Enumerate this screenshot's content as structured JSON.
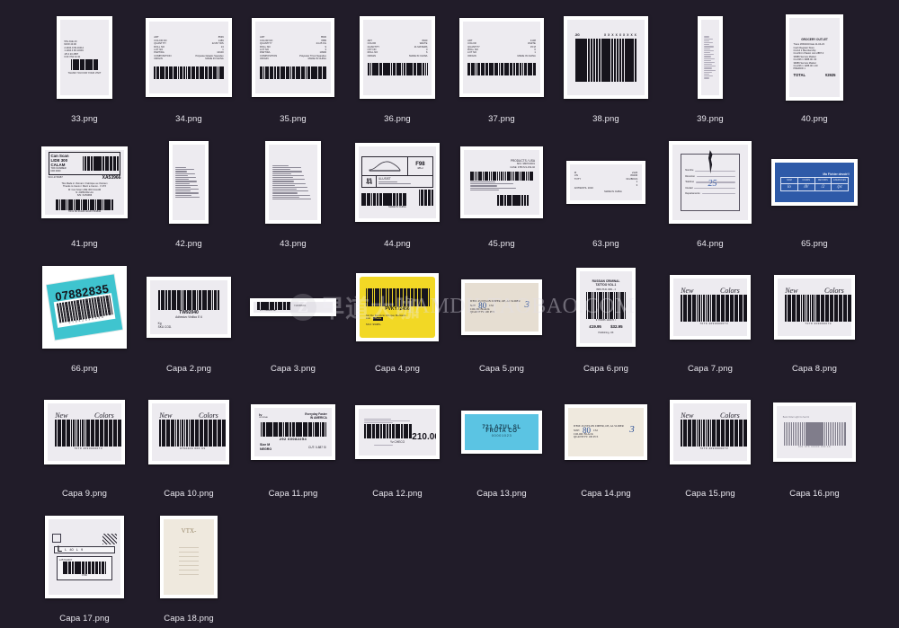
{
  "app": {
    "background_color": "#211c29",
    "view": "thumbnail-grid",
    "columns": 8
  },
  "watermark": {
    "logo_letter": "Z",
    "text_cn": "早道大咖",
    "text_en": "IAMDK.TAOBAO.COM"
  },
  "files": [
    {
      "name": "33.png",
      "kind": "receipt-tall",
      "w": 62,
      "h": 92,
      "paper": "paper",
      "content": {
        "lines": [
          "5TH AVE   20",
          "NOW 43.00",
          "2.2464.9  99.10414",
          "1.1194.4  90.13404",
          "1/5  4  20.4587",
          "0.00   7/64   44.31"
        ],
        "barcode": true,
        "footer": "THANK YOU FOR YOUR VISIT"
      }
    },
    {
      "name": "34.png",
      "kind": "care-label",
      "w": 96,
      "h": 88,
      "paper": "paper",
      "content": {
        "fields": [
          [
            "ART",
            "8539"
          ],
          [
            "COLOR NO",
            "1489"
          ],
          [
            "QUANTITY",
            "22.80 YDS"
          ],
          [
            "ROLL NO",
            "13"
          ],
          [
            "LOT NO",
            "1"
          ],
          [
            "PARTIDA",
            "10100"
          ],
          [
            "COMPOSITION",
            "Polyester Elastic Spandex"
          ],
          [
            "ORIGIN",
            "MADE IN CHINA"
          ]
        ],
        "barcode": true
      }
    },
    {
      "name": "35.png",
      "kind": "care-label",
      "w": 92,
      "h": 88,
      "paper": "paper",
      "content": {
        "fields": [
          [
            "ART",
            "8530"
          ],
          [
            "COLOR NO",
            "7885"
          ],
          [
            "QUANTITY",
            "24.25 KG"
          ],
          [
            "ROLL NO",
            "9"
          ],
          [
            "LOT NO",
            "3"
          ],
          [
            "PARTIDA",
            "10900"
          ],
          [
            "COMPOSITION",
            "Polyester Tricot Spandex"
          ],
          [
            "ORIGIN",
            "MADE IN CHINA"
          ]
        ],
        "barcode": true
      }
    },
    {
      "name": "36.png",
      "kind": "crumpled-label",
      "w": 84,
      "h": 92,
      "paper": "paper",
      "content": {
        "fields": [
          [
            "ART",
            "8020"
          ],
          [
            "COLOR",
            "WHITE"
          ],
          [
            "QUANTITY",
            "21 MATERS"
          ],
          [
            "LOT NO",
            "3"
          ],
          [
            "ROLL NO",
            "6"
          ],
          [
            "ORIGIN",
            "MADE IN CHINA"
          ]
        ],
        "barcode": true
      }
    },
    {
      "name": "37.png",
      "kind": "crumpled-label",
      "w": 94,
      "h": 88,
      "paper": "paper",
      "content": {
        "fields": [
          [
            "ART",
            "4138"
          ],
          [
            "COLOR",
            "WHITE"
          ],
          [
            "QUANTITY",
            "15 M"
          ],
          [
            "ROLL NO",
            "6"
          ],
          [
            "LOT NO",
            "1"
          ],
          [
            "ORIGIN",
            "MADE IN CHINA"
          ]
        ],
        "barcode": true
      }
    },
    {
      "name": "38.png",
      "kind": "big-barcode",
      "w": 94,
      "h": 92,
      "paper": "paper",
      "content": {
        "code": "X X X X X X X X X",
        "prefix": "JIG"
      }
    },
    {
      "name": "39.png",
      "kind": "narrow-strip",
      "w": 28,
      "h": 92,
      "paper": "paper",
      "content": {
        "lines": 22
      }
    },
    {
      "name": "40.png",
      "kind": "receipt-tall",
      "w": 64,
      "h": 96,
      "paper": "paper",
      "content": {
        "header": "GROCERY OUTLET",
        "lines": [
          "Trans  1650234    Date 11-04-23",
          "Cash Register         Store",
          "CL214  1  Membership",
          "CL1234  1  Plastic mini   2887.0",
          "30986   Service Market",
          "CL1336  1  3988.00        .00",
          "39089   Service Market",
          "CL1236  1  1288.00       1.00",
          "PREPAID 1"
        ],
        "total_label": "TOTAL",
        "total_value": "¥2925"
      }
    },
    {
      "name": "41.png",
      "kind": "shipping-label",
      "w": 96,
      "h": 80,
      "paper": "paper",
      "content": {
        "title1": "Can Scan",
        "title2": "LIDE 300",
        "title3": "CALAM",
        "sub1": "TRK NUMBER",
        "sub2": "DIR 0000",
        "ref": "XA53966",
        "barcode": true,
        "desc": [
          "TEL  Made in Vietnam / Fabrique au Vietnam",
          "Thanks to Canon / Merci a Canon   -   V  27X",
          "M:  Can Scan LIDE 300 CALAM",
          "N:  2486C002-AA",
          "S/N:   XA53966"
        ],
        "footer": "TR13  B1  0013D-4A3F1  56384d"
      }
    },
    {
      "name": "42.png",
      "kind": "receipt-tall",
      "w": 44,
      "h": 92,
      "paper": "paper",
      "content": {
        "lines": 16
      }
    },
    {
      "name": "43.png",
      "kind": "receipt-tall",
      "w": 62,
      "h": 92,
      "paper": "paper",
      "content": {
        "lines": 18
      }
    },
    {
      "name": "44.png",
      "kind": "shoe-box-label",
      "w": 94,
      "h": 88,
      "paper": "paper",
      "content": {
        "code": "F98",
        "art": "486-2",
        "size_label": "BR",
        "size": "44",
        "sku": "ILLUSIST",
        "barcode": true,
        "origin": "MADE IN CHINA"
      }
    },
    {
      "name": "45.png",
      "kind": "poly-bag-label",
      "w": 92,
      "h": 80,
      "paper": "paper",
      "content": {
        "company": "PRODUCTS / USA",
        "lines": [
          "SKU: 9867C0001",
          "CASE: 3781721-152-02"
        ],
        "barcode_top": true,
        "barcode_bottom": true
      }
    },
    {
      "name": "63.png",
      "kind": "torn-label",
      "w": 88,
      "h": 48,
      "paper": "paper",
      "content": {
        "fields": [
          [
            "M",
            "2120"
          ],
          [
            "UN",
            "80430"
          ],
          [
            "TOTY",
            "33.28KGS"
          ],
          [
            "",
            "1"
          ],
          [
            "",
            "3"
          ],
          [
            "ANTIESTIL 1010",
            ""
          ]
        ],
        "origin": "MADE IN CHINA"
      }
    },
    {
      "name": "64.png",
      "kind": "hand-ink-label",
      "w": 92,
      "h": 92,
      "paper": "paper",
      "content": {
        "fields": [
          "Nombre",
          "Direccion",
          "Telefono",
          "Ciudad",
          "Departamento"
        ],
        "ink": "25"
      }
    },
    {
      "name": "65.png",
      "kind": "blue-table-label",
      "w": 96,
      "h": 52,
      "paper": "blue",
      "content": {
        "title": "Ma Fichier devoir!!",
        "headers": [
          "NOM",
          "COURS",
          "DEVOIRS",
          "EXERCICES"
        ],
        "cells": [
          "lo",
          "/8/",
          "/2",
          "/pc"
        ]
      }
    },
    {
      "name": "66.png",
      "kind": "teal-tag",
      "w": 94,
      "h": 92,
      "paper": "teal",
      "content": {
        "number": "07882835",
        "barcode": true,
        "digits": "0 7 8 8 2 8 3 5 0 9 0"
      }
    },
    {
      "name": "Capa 2.png",
      "kind": "barcode-card",
      "w": 94,
      "h": 68,
      "paper": "paper",
      "content": {
        "code": "TW92040",
        "desc": "Adhesivo Vinilico E 6",
        "fields": [
          "Kg",
          "SKU  COD."
        ],
        "barcode": true
      }
    },
    {
      "name": "Capa 3.png",
      "kind": "thin-barcode-strip",
      "w": 96,
      "h": 20,
      "paper": "paper",
      "content": {
        "code": "Y123456001",
        "barcode": true,
        "sub": "BY COMMERCIAL"
      }
    },
    {
      "name": "Capa 4.png",
      "kind": "yellow-label",
      "w": 92,
      "h": 76,
      "paper": "yellow",
      "content": {
        "code": "PVKY72456",
        "desc": "Set De Ejercicio Afinque Mercado",
        "line2": "Lite:",
        "highlight": "Batia",
        "line3": "SKU: 99489-",
        "barcode": true
      }
    },
    {
      "name": "Capa 5.png",
      "kind": "zipper-label",
      "w": 90,
      "h": 62,
      "paper": "paper-warm",
      "content": {
        "item": "ITEM: 45 NYLON ZIPPER, OE, AL SLIDER",
        "size_label": "SIZE",
        "size": "80",
        "unit": "CM",
        "color": "COLOR: BLACK",
        "qty": "QUANTITY: 100 PCS",
        "ink": "3"
      }
    },
    {
      "name": "Capa 6.png",
      "kind": "book-barcode",
      "w": 66,
      "h": 88,
      "paper": "paper",
      "content": {
        "title1": "RUSSIAN CRIMINAL",
        "title2": "TATTOO VOL.1",
        "isbn_top": "ISBN   78-01   3841  -  4",
        "isbn": "9 780955 142076 >",
        "price_gbp": "£19.95",
        "price_usd": "$32.95",
        "publisher": "Publishing, UK",
        "barcode": true
      }
    },
    {
      "name": "Capa 7.png",
      "kind": "new-colors",
      "w": 90,
      "h": 72,
      "paper": "paper",
      "content": {
        "word1": "New",
        "word2": "Colors",
        "code_side": "Cod. 77",
        "digits": "7079 4090000073",
        "barcode": true
      }
    },
    {
      "name": "Capa 8.png",
      "kind": "new-colors",
      "w": 90,
      "h": 72,
      "paper": "paper",
      "content": {
        "word1": "New",
        "word2": "Colors",
        "code_side": "Cod. 77",
        "digits": "7079  409000073",
        "barcode": true
      }
    },
    {
      "name": "Capa 9.png",
      "kind": "new-colors",
      "w": 90,
      "h": 72,
      "paper": "paper",
      "content": {
        "word1": "New",
        "word2": "Colors",
        "code_side": "Cod. 77",
        "digits": "7079  4090000073",
        "barcode": true
      }
    },
    {
      "name": "Capa 10.png",
      "kind": "new-colors",
      "w": 90,
      "h": 72,
      "paper": "paper",
      "content": {
        "word1": "New",
        "word2": "Colors",
        "code_side": "Cod. 77",
        "digits": "0792409  000 93",
        "barcode": true
      }
    },
    {
      "name": "Capa 11.png",
      "kind": "garment-label",
      "w": 94,
      "h": 62,
      "paper": "paper",
      "content": {
        "brand": "Everyday Faster",
        "brand2": "IN AMERICA",
        "code": "292  60082254",
        "size_label": "Size M",
        "color": "NEGRO",
        "cut": "CUT: 0-887   S/",
        "barcode": true
      }
    },
    {
      "name": "Capa 12.png",
      "kind": "price-label",
      "w": 94,
      "h": 60,
      "paper": "paper",
      "content": {
        "price": "210.00",
        "line1": "A-1/kg",
        "line2": "Fresh",
        "footer": "Yz  CHECO",
        "barcode": true
      }
    },
    {
      "name": "Capa 13.png",
      "kind": "cyan-label",
      "w": 90,
      "h": 48,
      "paper": "cyan",
      "content": {
        "line1": "721 AZUL SL",
        "line2": "FRUTA CO",
        "line3": "00001023"
      }
    },
    {
      "name": "Capa 14.png",
      "kind": "zipper-label",
      "w": 92,
      "h": 62,
      "paper": "paper-cream",
      "content": {
        "item": "ITEM: 45 NYLON ZIPPER, OE, AL SLIDER",
        "size_label": "SIZE:",
        "size": "80",
        "unit": "CM",
        "color": "COLOR: BLACK",
        "qty": "QUANTITY: 100 PCS",
        "ink": "3"
      }
    },
    {
      "name": "Capa 15.png",
      "kind": "new-colors",
      "w": 90,
      "h": 72,
      "paper": "paper",
      "content": {
        "word1": "New",
        "word2": "Colors",
        "code_side": "Cod. 77",
        "digits": "7079  4090000073",
        "barcode": true
      }
    },
    {
      "name": "Capa 16.png",
      "kind": "faint-barcode",
      "w": 92,
      "h": 66,
      "paper": "paper",
      "content": {
        "top": "Book Order   Light Co Set   01",
        "digits": "901 976 09990 000 18",
        "barcode": true
      }
    },
    {
      "name": "Capa 17.png",
      "kind": "multi-label",
      "w": 88,
      "h": 92,
      "paper": "paper",
      "content": {
        "size": "L",
        "sizes": [
          "L",
          "40",
          "L",
          "9"
        ],
        "sku": "L2574U007",
        "code": "0706",
        "barcode": true
      }
    },
    {
      "name": "Capa 18.png",
      "kind": "aged-paper",
      "w": 64,
      "h": 92,
      "paper": "paper-cream",
      "content": {
        "ink": "VTX-"
      }
    }
  ]
}
